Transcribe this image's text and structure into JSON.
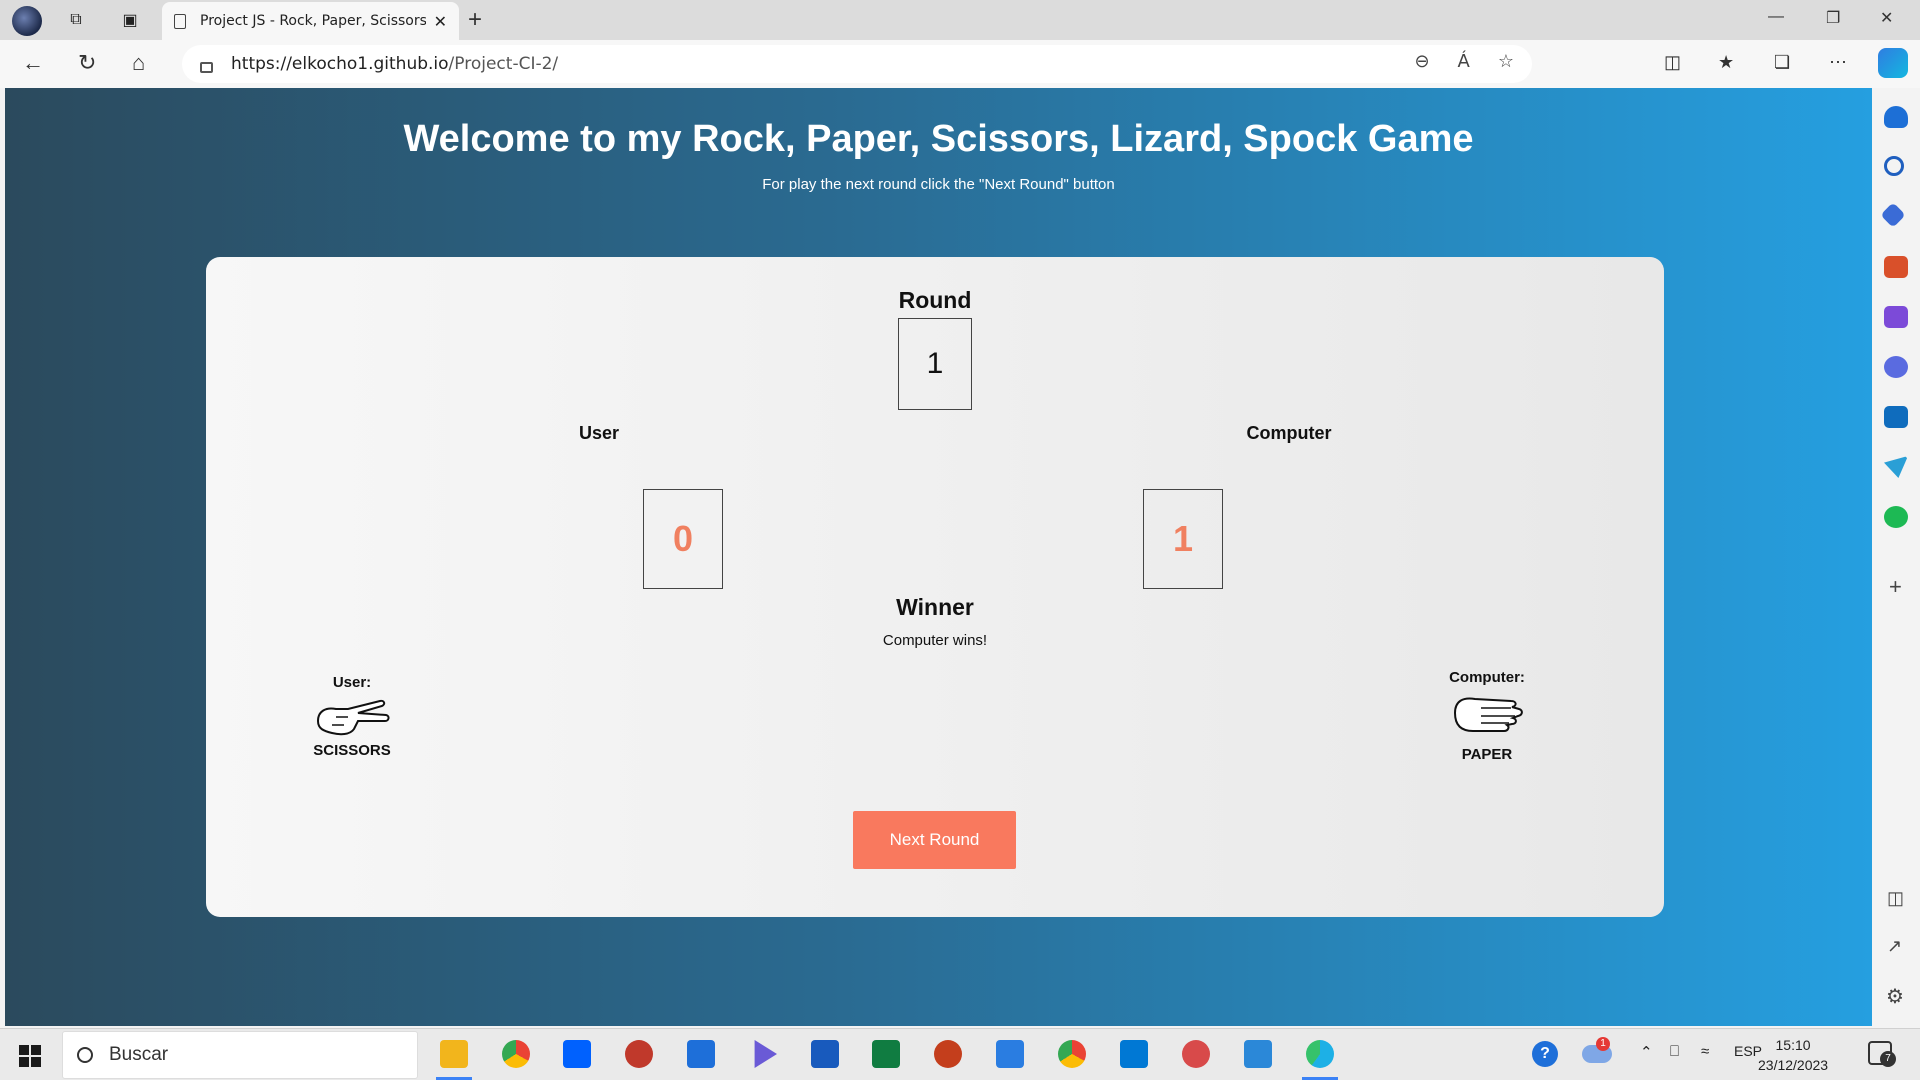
{
  "browser": {
    "tab_title": "Project JS - Rock, Paper, Scissors, Lizard, Spock",
    "url_host": "https://elkocho1.github.io",
    "url_path": "/Project-CI-2/",
    "read_aloud_label": "Á"
  },
  "page": {
    "title": "Welcome to my Rock, Paper, Scissors, Lizard, Spock Game",
    "subtitle": "For play the next round click the \"Next Round\" button",
    "round_label": "Round",
    "round_value": "1",
    "user_label": "User",
    "user_score": "0",
    "computer_label": "Computer",
    "computer_score": "1",
    "user_choice_label": "User:",
    "user_choice": "SCISSORS",
    "computer_choice_label": "Computer:",
    "computer_choice": "PAPER",
    "winner_label": "Winner",
    "winner_text": "Computer wins!",
    "next_button": "Next Round"
  },
  "colors": {
    "accent": "#f9795e",
    "score": "#f08060",
    "bg_left": "#2b4a5d",
    "bg_right": "#259fe0"
  },
  "taskbar": {
    "search_placeholder": "Buscar",
    "language": "ESP",
    "time": "15:10",
    "date": "23/12/2023",
    "notification_count": "7",
    "cloud_badge": "1",
    "help_badge": "?"
  }
}
